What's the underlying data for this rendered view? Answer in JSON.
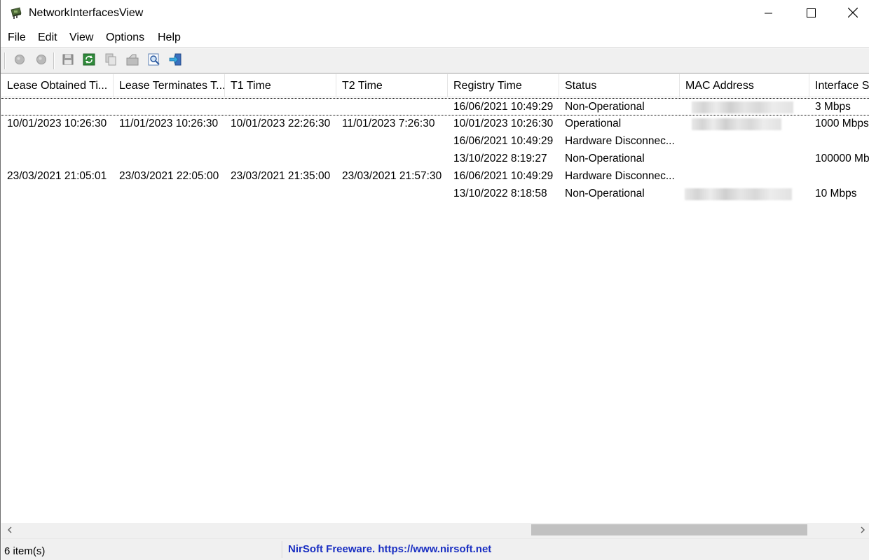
{
  "window": {
    "title": "NetworkInterfacesView"
  },
  "menu": [
    "File",
    "Edit",
    "View",
    "Options",
    "Help"
  ],
  "toolbar": {
    "buttons": [
      "enable-icon",
      "disable-icon",
      "save-icon",
      "refresh-icon",
      "copy-icon",
      "properties-icon",
      "find-icon",
      "exit-icon"
    ]
  },
  "table": {
    "columns": [
      "Lease Obtained Ti...",
      "Lease Terminates T...",
      "T1 Time",
      "T2 Time",
      "Registry Time",
      "Status",
      "MAC Address",
      "Interface S"
    ],
    "rows": [
      {
        "lease_obtained": "",
        "lease_terminates": "",
        "t1": "",
        "t2": "",
        "registry": "16/06/2021 10:49:29",
        "status": "Non-Operational",
        "mac": "",
        "speed": "3 Mbps"
      },
      {
        "lease_obtained": "10/01/2023 10:26:30",
        "lease_terminates": "11/01/2023 10:26:30",
        "t1": "10/01/2023 22:26:30",
        "t2": "11/01/2023 7:26:30",
        "registry": "10/01/2023 10:26:30",
        "status": "Operational",
        "mac": "",
        "speed": "1000 Mbps"
      },
      {
        "lease_obtained": "",
        "lease_terminates": "",
        "t1": "",
        "t2": "",
        "registry": "16/06/2021 10:49:29",
        "status": "Hardware Disconnec...",
        "mac": "",
        "speed": ""
      },
      {
        "lease_obtained": "",
        "lease_terminates": "",
        "t1": "",
        "t2": "",
        "registry": "13/10/2022 8:19:27",
        "status": "Non-Operational",
        "mac": "",
        "speed": "100000 Mb"
      },
      {
        "lease_obtained": "23/03/2021 21:05:01",
        "lease_terminates": "23/03/2021 22:05:00",
        "t1": "23/03/2021 21:35:00",
        "t2": "23/03/2021 21:57:30",
        "registry": "16/06/2021 10:49:29",
        "status": "Hardware Disconnec...",
        "mac": "",
        "speed": ""
      },
      {
        "lease_obtained": "",
        "lease_terminates": "",
        "t1": "",
        "t2": "",
        "registry": "13/10/2022 8:18:58",
        "status": "Non-Operational",
        "mac": "",
        "speed": "10 Mbps"
      }
    ]
  },
  "status_bar": {
    "count": "6 item(s)",
    "link": "NirSoft Freeware. https://www.nirsoft.net"
  },
  "colors": {
    "link": "#1a2fc2",
    "toolbar_bg": "#f0f0f0",
    "scroll_thumb": "#c1c1c1"
  }
}
